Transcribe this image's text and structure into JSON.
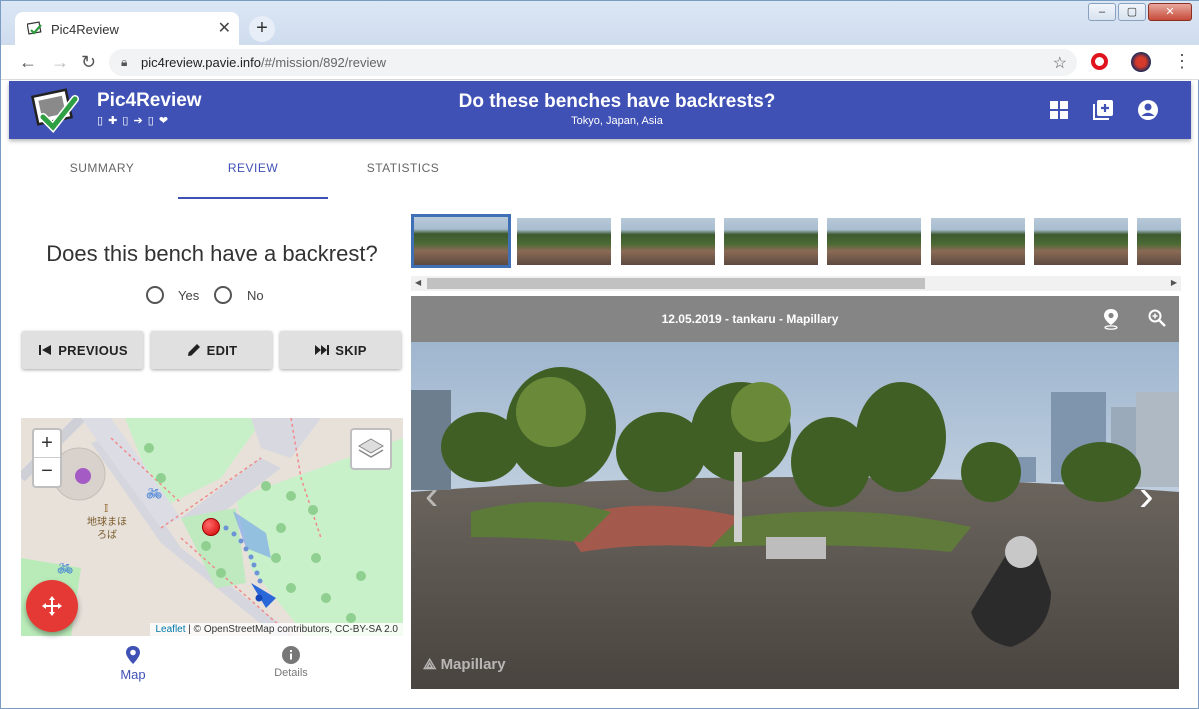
{
  "browser": {
    "tab_title": "Pic4Review",
    "tab_close": "✕",
    "new_tab": "+",
    "url_host": "pic4review.pavie.info",
    "url_path": "/#/mission/892/review",
    "window_buttons": [
      "–",
      "▢",
      "✕"
    ]
  },
  "app": {
    "title": "Pic4Review",
    "subtitle": "▯ ✚ ▯ ➔ ▯ ❤",
    "mission_title": "Do these benches have backrests?",
    "mission_location": "Tokyo, Japan, Asia",
    "header_icons": [
      "grid-icon",
      "add-box-icon",
      "account-icon"
    ],
    "accent": "#3f51b5"
  },
  "tabs": {
    "summary": "SUMMARY",
    "review": "REVIEW",
    "statistics": "STATISTICS"
  },
  "question": {
    "text": "Does this bench have a backrest?",
    "options": [
      "Yes",
      "No"
    ]
  },
  "buttons": {
    "previous": "PREVIOUS",
    "edit": "EDIT",
    "skip": "SKIP"
  },
  "map": {
    "zoom_in": "+",
    "zoom_out": "−",
    "attribution_leaflet": "Leaflet",
    "attribution_rest": " | © OpenStreetMap contributors, CC-BY-SA 2.0",
    "poi_label": "地球まほろば"
  },
  "bottom_nav": {
    "map": "Map",
    "details": "Details"
  },
  "viewer": {
    "caption": "12.05.2019 - tankaru - Mapillary",
    "watermark": "Mapillary",
    "thumbnail_count": 8
  }
}
